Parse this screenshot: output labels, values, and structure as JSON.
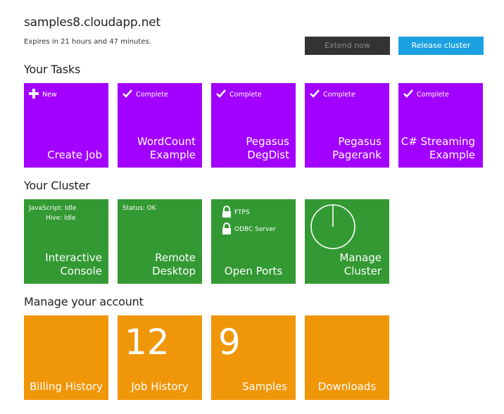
{
  "header": {
    "host": "samples8.cloudapp.net",
    "expires": "Expires in 21 hours and 47 minutes.",
    "extend_label": "Extend now",
    "release_label": "Release cluster"
  },
  "tasks": {
    "heading": "Your Tasks",
    "tiles": [
      {
        "badge": "New",
        "icon": "plus-icon",
        "title_line1": "",
        "title_line2": "Create Job"
      },
      {
        "badge": "Complete",
        "icon": "checkmark-icon",
        "title_line1": "WordCount",
        "title_line2": "Example"
      },
      {
        "badge": "Complete",
        "icon": "checkmark-icon",
        "title_line1": "Pegasus",
        "title_line2": "DegDist"
      },
      {
        "badge": "Complete",
        "icon": "checkmark-icon",
        "title_line1": "Pegasus",
        "title_line2": "Pagerank"
      },
      {
        "badge": "Complete",
        "icon": "checkmark-icon",
        "title_line1": "C# Streaming",
        "title_line2": "Example"
      }
    ]
  },
  "cluster": {
    "heading": "Your Cluster",
    "console": {
      "status_js": "JavaScript: Idle",
      "status_hive": "Hive: Idle",
      "title_line1": "Interactive",
      "title_line2": "Console"
    },
    "remote": {
      "status": "Status: OK",
      "title_line1": "Remote",
      "title_line2": "Desktop"
    },
    "ports": {
      "port1": "FTPS",
      "port2": "ODBC Server",
      "icon": "lock-icon",
      "title": "Open Ports"
    },
    "manage": {
      "icon": "clock-icon",
      "title_line1": "Manage",
      "title_line2": "Cluster"
    }
  },
  "account": {
    "heading": "Manage your account",
    "billing": {
      "title": "Billing History"
    },
    "jobs": {
      "count": "12",
      "title": "Job History"
    },
    "samples": {
      "count": "9",
      "title": "Samples"
    },
    "downloads": {
      "title": "Downloads"
    }
  },
  "colors": {
    "tasks_tile": "#a200ff",
    "cluster_tile": "#339933",
    "account_tile": "#f09609",
    "extend_button": "#333333",
    "release_button": "#1ba1e2"
  }
}
